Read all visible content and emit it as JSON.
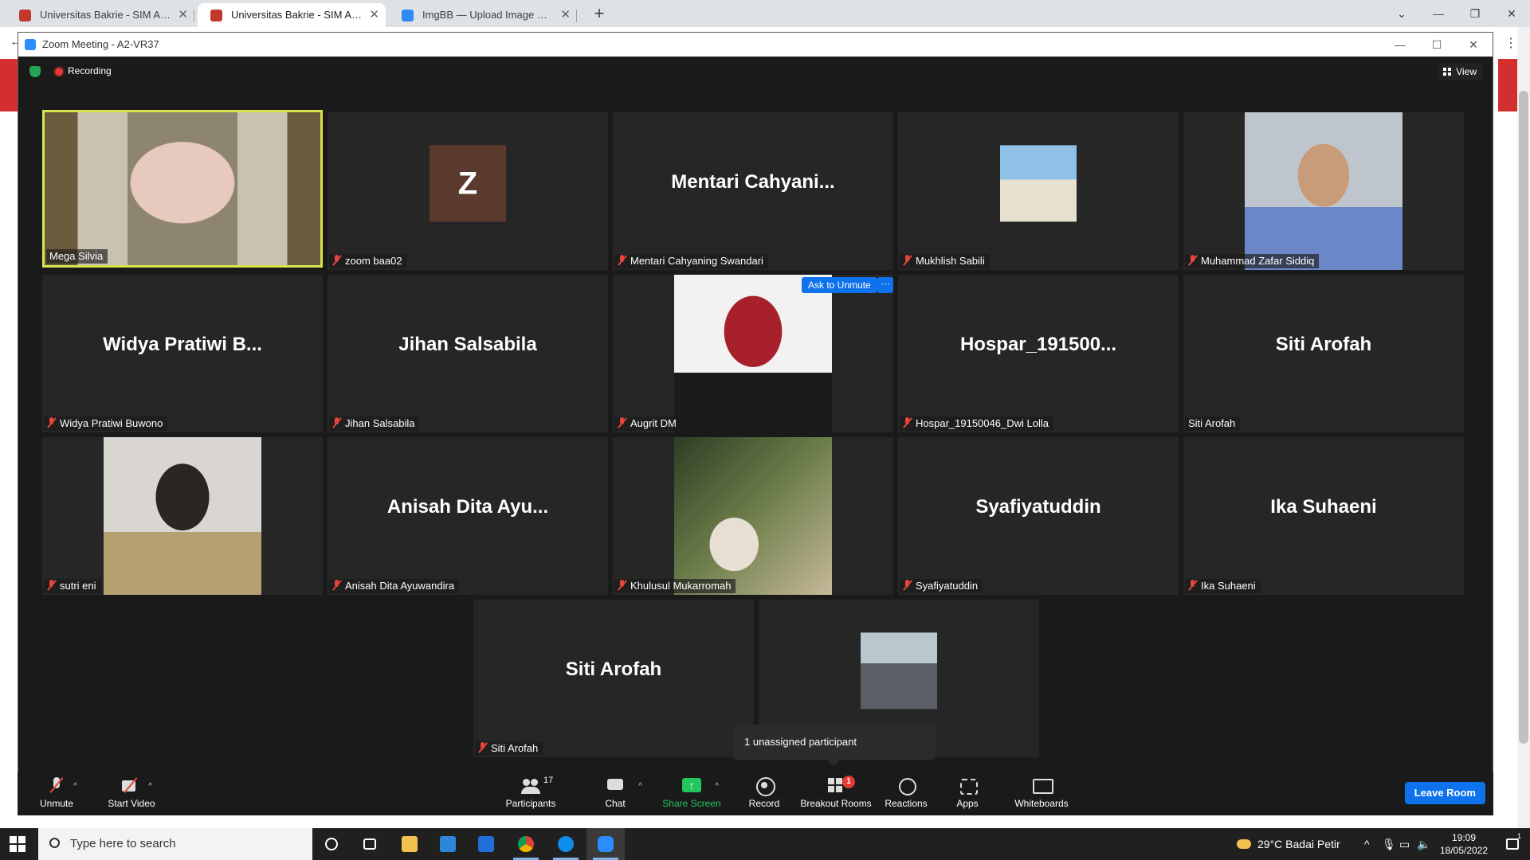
{
  "browser": {
    "tabs": [
      {
        "title": "Universitas Bakrie - SIM Akadem",
        "active": false
      },
      {
        "title": "Universitas Bakrie - SIM Akadem",
        "active": true
      },
      {
        "title": "ImgBB — Upload Image — Free",
        "active": false
      }
    ],
    "new_tab": "+",
    "controls": {
      "dropdown": "⌄",
      "minimize": "—",
      "restore": "❐",
      "close": "✕"
    }
  },
  "zoom": {
    "window_title": "Zoom Meeting - A2-VR37",
    "recording_label": "Recording",
    "view_label": "View",
    "ask_to_unmute": "Ask to Unmute",
    "more_label": "···",
    "tooltip": "1 unassigned participant",
    "participants": [
      {
        "display": "",
        "nameplate": "Mega Silvia",
        "muted": false,
        "kind": "video",
        "active": true
      },
      {
        "display": "Z",
        "nameplate": "zoom baa02",
        "muted": true,
        "kind": "initial"
      },
      {
        "display": "Mentari  Cahyani...",
        "nameplate": "Mentari Cahyaning Swandari",
        "muted": true,
        "kind": "text"
      },
      {
        "display": "",
        "nameplate": "Mukhlish Sabili",
        "muted": true,
        "kind": "thumb"
      },
      {
        "display": "",
        "nameplate": "Muhammad Zafar Siddiq",
        "muted": true,
        "kind": "photo"
      },
      {
        "display": "Widya Pratiwi B...",
        "nameplate": "Widya Pratiwi Buwono",
        "muted": true,
        "kind": "text"
      },
      {
        "display": "Jihan Salsabila",
        "nameplate": "Jihan Salsabila",
        "muted": true,
        "kind": "text"
      },
      {
        "display": "",
        "nameplate": "Augrit DM",
        "muted": true,
        "kind": "photo"
      },
      {
        "display": "Hospar_191500...",
        "nameplate": "Hospar_19150046_Dwi Lolla",
        "muted": true,
        "kind": "text"
      },
      {
        "display": "Siti Arofah",
        "nameplate": "Siti Arofah",
        "muted": false,
        "kind": "text"
      },
      {
        "display": "",
        "nameplate": "sutri eni",
        "muted": true,
        "kind": "photo"
      },
      {
        "display": "Anisah  Dita  Ayu...",
        "nameplate": "Anisah Dita Ayuwandira",
        "muted": true,
        "kind": "text"
      },
      {
        "display": "",
        "nameplate": "Khulusul Mukarromah",
        "muted": true,
        "kind": "photo"
      },
      {
        "display": "Syafiyatuddin",
        "nameplate": "Syafiyatuddin",
        "muted": true,
        "kind": "text"
      },
      {
        "display": "Ika Suhaeni",
        "nameplate": "Ika Suhaeni",
        "muted": true,
        "kind": "text"
      },
      {
        "display": "Siti Arofah",
        "nameplate": "Siti Arofah",
        "muted": true,
        "kind": "text"
      },
      {
        "display": "",
        "nameplate": "",
        "muted": false,
        "kind": "thumb"
      }
    ],
    "toolbar": {
      "unmute": "Unmute",
      "start_video": "Start Video",
      "participants": "Participants",
      "participants_count": "17",
      "chat": "Chat",
      "share_screen": "Share Screen",
      "record": "Record",
      "breakout_rooms": "Breakout Rooms",
      "breakout_badge": "1",
      "reactions": "Reactions",
      "apps": "Apps",
      "whiteboards": "Whiteboards",
      "leave_room": "Leave Room",
      "caret": "^"
    }
  },
  "taskbar": {
    "search_placeholder": "Type here to search",
    "weather": "29°C  Badai Petir",
    "time": "19:09",
    "date": "18/05/2022",
    "tray_chevron": "^",
    "notification_count": "1"
  },
  "colors": {
    "zoom_blue": "#0e72ed",
    "active_speaker": "#d9e54d",
    "mute_red": "#e5453b",
    "share_green": "#23c55e"
  }
}
